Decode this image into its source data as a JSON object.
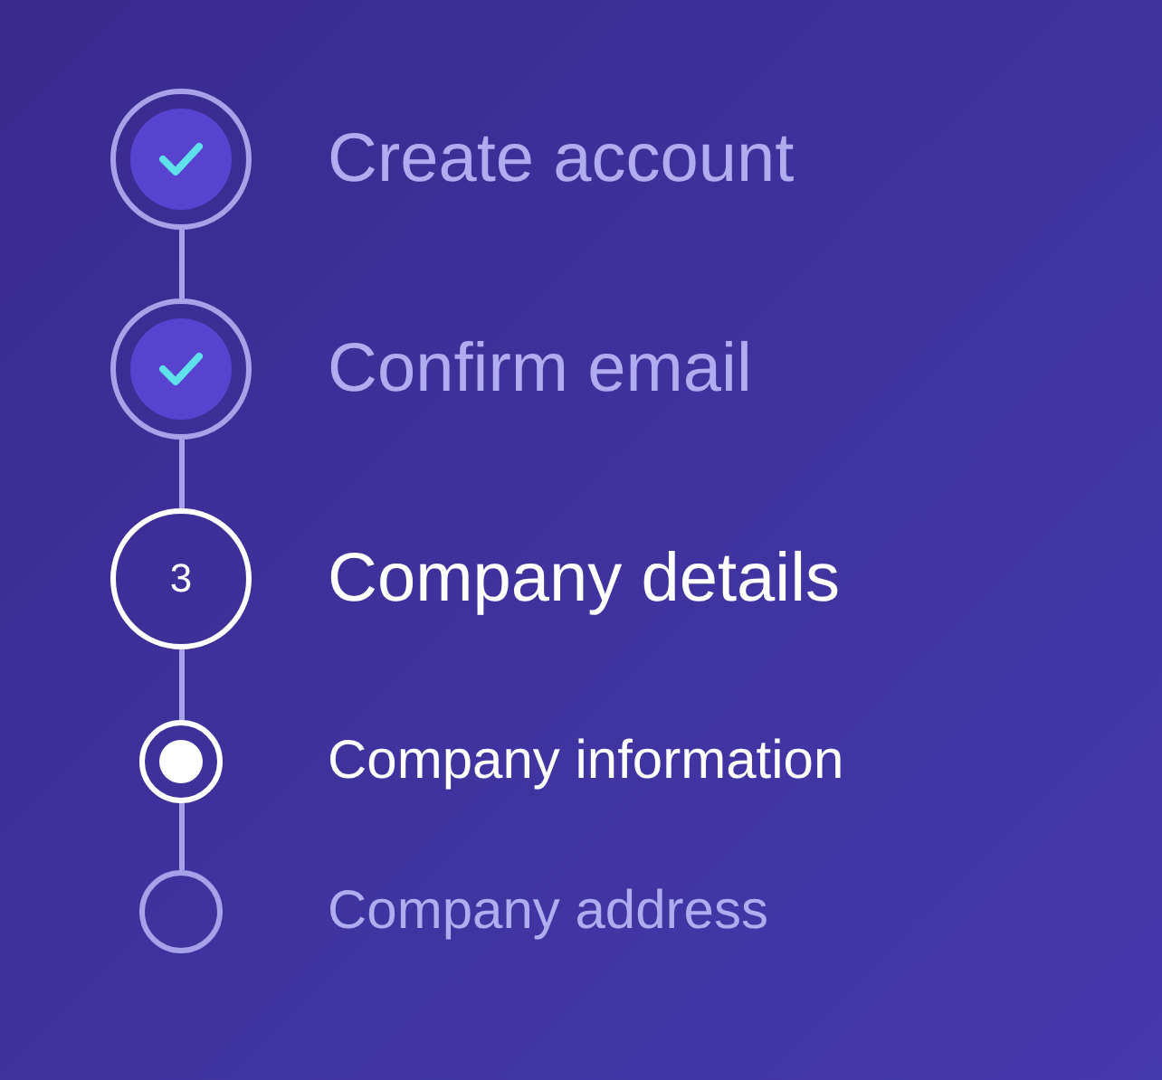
{
  "steps": [
    {
      "label": "Create account",
      "complete": true,
      "current": false
    },
    {
      "label": "Confirm email",
      "complete": true,
      "current": false
    },
    {
      "label": "Company details",
      "complete": false,
      "current": true,
      "number": "3",
      "children": [
        {
          "label": "Company information",
          "current": true
        },
        {
          "label": "Company address",
          "current": false
        }
      ]
    }
  ]
}
